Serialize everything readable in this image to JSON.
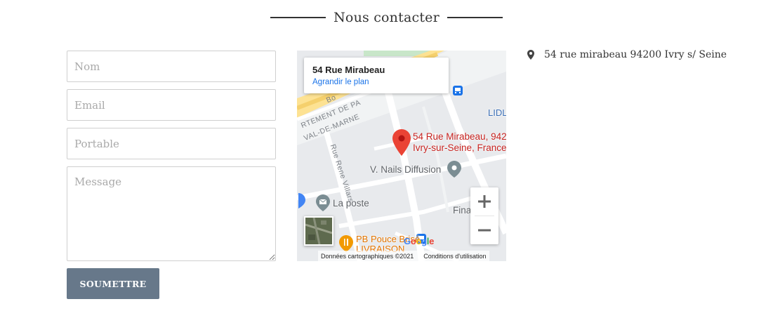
{
  "section": {
    "title": "Nous contacter"
  },
  "form": {
    "name_placeholder": "Nom",
    "email_placeholder": "Email",
    "phone_placeholder": "Portable",
    "message_placeholder": "Message",
    "submit_label": "SOUMETTRE"
  },
  "map": {
    "place_title": "54 Rue Mirabeau",
    "enlarge_link": "Agrandir le plan",
    "pin_line1": "54 Rue Mirabeau, 942",
    "pin_line2": "Ivry-sur-Seine, France",
    "poi_nails": "V. Nails Diffusion",
    "poi_laposte": "La poste",
    "poi_lidl": "LIDL",
    "poi_pb_line1": "PB Pouce Brisé",
    "poi_pb_line2": "LIVRAISON",
    "poi_fina": "Fina",
    "street_rene": "Rue Rene Villars",
    "street_dept": "RTEMENT DE PA",
    "street_val": "VAL-DE-MARNE",
    "street_bo": "Bo",
    "google_logo": "Google",
    "footer_data": "Données cartographiques ©2021",
    "footer_terms": "Conditions d'utilisation",
    "zoom_in_symbol": "+",
    "zoom_out_symbol": "−"
  },
  "contact": {
    "address": "54 rue mirabeau 94200 Ivry s/ Seine"
  },
  "colors": {
    "button_bg": "#67788a",
    "pin_red": "#ea4335",
    "link_blue": "#1a73e8"
  },
  "icons": {
    "address": "map-marker-icon",
    "pin": "map-pin-icon",
    "bus": "bus-stop-icon",
    "poi": "place-icon",
    "restaurant": "restaurant-icon"
  }
}
